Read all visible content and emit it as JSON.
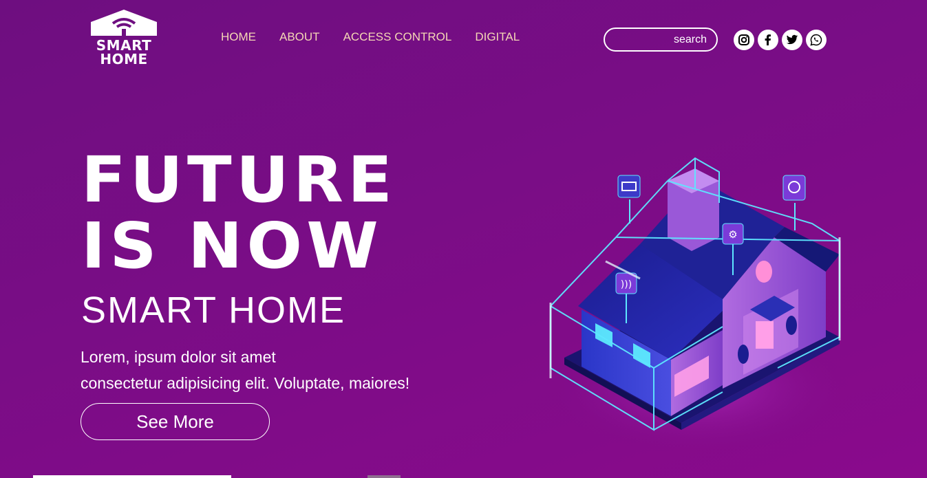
{
  "logo": {
    "line1": "SMART",
    "line2": "HOME"
  },
  "nav": {
    "items": [
      {
        "label": "HOME"
      },
      {
        "label": "ABOUT"
      },
      {
        "label": "ACCESS CONTROL"
      },
      {
        "label": "DIGITAL"
      }
    ]
  },
  "search": {
    "placeholder": "search"
  },
  "socials": [
    "instagram-icon",
    "facebook-icon",
    "twitter-icon",
    "whatsapp-icon"
  ],
  "hero": {
    "title_line1": "FUTURE",
    "title_line2": "IS NOW",
    "subtitle": "SMART HOME",
    "text_line1": "Lorem, ipsum dolor sit amet",
    "text_line2": "consectetur adipisicing elit. Voluptate, maiores!",
    "button": "See More"
  },
  "colors": {
    "background": "#7a0d86",
    "nav_text": "#f5d7b5",
    "accent_glow": "#5ee7ff"
  }
}
